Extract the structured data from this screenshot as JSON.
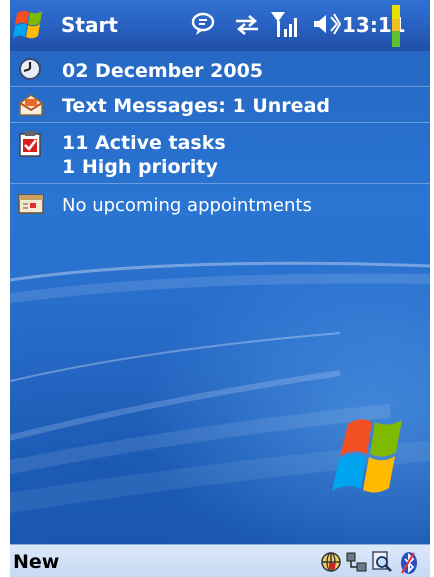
{
  "titlebar": {
    "start_label": "Start",
    "clock": "13:11",
    "icons": [
      "windows-start-flag-icon",
      "message-bubble-icon",
      "sync-arrows-icon",
      "signal-strength-icon",
      "speaker-volume-icon",
      "battery-icon"
    ]
  },
  "today": {
    "date": "02 December 2005",
    "messages": "Text Messages: 1 Unread",
    "tasks_line1": "11 Active tasks",
    "tasks_line2": "1 High priority",
    "appointments": "No upcoming appointments"
  },
  "menubar": {
    "left_softkey": "New",
    "system_icons": [
      "network-globe-icon",
      "connectivity-icon",
      "search-magnifier-icon",
      "bluetooth-icon"
    ]
  },
  "colors": {
    "titlebar": "#2a63c4",
    "background": "#2a6fcc",
    "menubar": "#c6d9f4"
  }
}
